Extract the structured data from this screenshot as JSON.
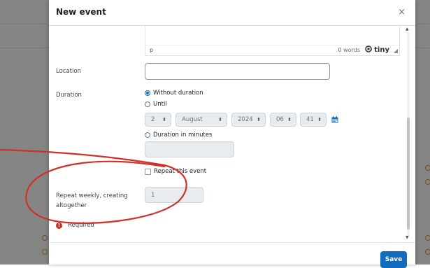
{
  "modal": {
    "title": "New event",
    "close_glyph": "×",
    "save_label": "Save"
  },
  "editor": {
    "path": "p",
    "word_count": "0 words",
    "brand": "tiny",
    "brand_icon": "tiny-logo-icon"
  },
  "location": {
    "label": "Location",
    "value": ""
  },
  "duration": {
    "label": "Duration",
    "options": {
      "without": "Without duration",
      "until": "Until",
      "minutes": "Duration in minutes"
    },
    "selected": "without",
    "until_date": {
      "day": "2",
      "month": "August",
      "year": "2024",
      "hour": "06",
      "minute": "41"
    },
    "minutes_value": ""
  },
  "repeat": {
    "checkbox_label": "Repeat this event",
    "checked": false,
    "weekly_label": "Repeat weekly, creating altogether",
    "weekly_value": "1"
  },
  "required_note": "Required",
  "colors": {
    "accent": "#0f6cbf",
    "required": "#ca3120",
    "annotation": "#d0302a"
  }
}
